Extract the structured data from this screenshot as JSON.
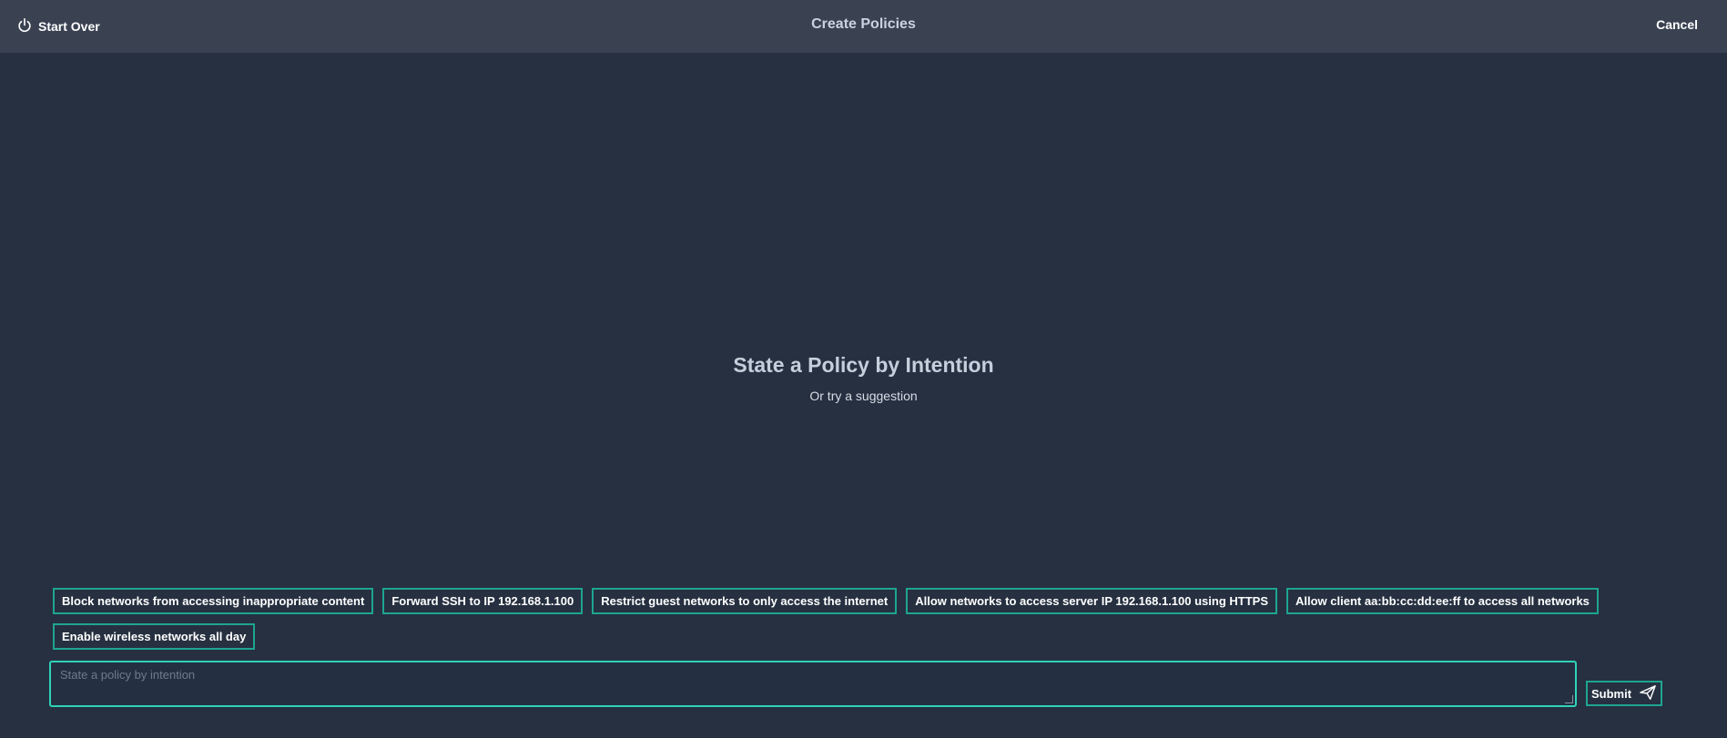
{
  "header": {
    "start_over_label": "Start Over",
    "title": "Create Policies",
    "cancel_label": "Cancel"
  },
  "hero": {
    "title": "State a Policy by Intention",
    "subtitle": "Or try a suggestion"
  },
  "suggestions": [
    "Block networks from accessing inappropriate content",
    "Forward SSH to IP 192.168.1.100",
    "Restrict guest networks to only access the internet",
    "Allow networks to access server IP 192.168.1.100 using HTTPS",
    "Allow client aa:bb:cc:dd:ee:ff to access all networks",
    "Enable wireless networks all day"
  ],
  "input": {
    "placeholder": "State a policy by intention",
    "value": ""
  },
  "submit_label": "Submit",
  "icons": {
    "start_over": "power-icon",
    "submit": "send-icon"
  },
  "colors": {
    "accent": "#1ea591",
    "input_focus": "#2fd3b8",
    "header_bg": "#3a4252",
    "page_bg": "#263040"
  }
}
